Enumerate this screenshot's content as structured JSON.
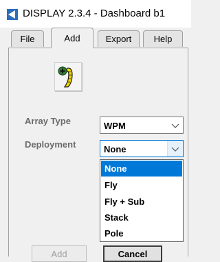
{
  "window": {
    "title": "DISPLAY 2.3.4 - Dashboard  b1",
    "icon": "triangle-left-icon"
  },
  "tabs": [
    {
      "label": "File",
      "active": false
    },
    {
      "label": "Add",
      "active": true
    },
    {
      "label": "Export",
      "active": false
    },
    {
      "label": "Help",
      "active": false
    }
  ],
  "toolbar": {
    "tool_icon": "add-array-icon"
  },
  "form": {
    "array_type": {
      "label": "Array Type",
      "value": "WPM"
    },
    "deployment": {
      "label": "Deployment",
      "value": "None"
    }
  },
  "deployment_options": [
    "None",
    "Fly",
    "Fly + Sub",
    "Stack",
    "Pole"
  ],
  "buttons": {
    "add_label": "Add",
    "cancel_label": "Cancel"
  },
  "colors": {
    "selection": "#0078d7",
    "tool_icon_green": "#2e7d32",
    "tool_icon_yellow": "#f5d800"
  }
}
